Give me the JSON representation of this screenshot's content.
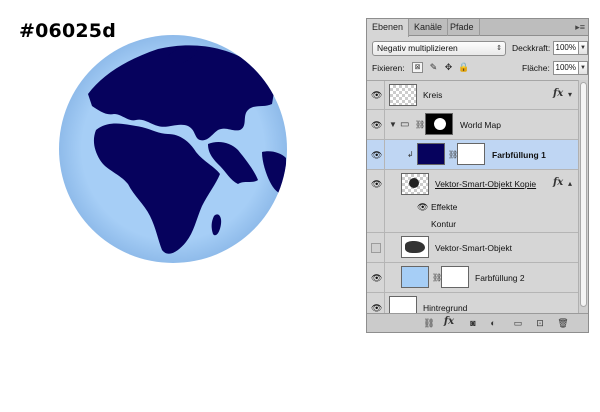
{
  "canvas_label": "#06025d",
  "colors": {
    "navy": "#06025d",
    "light_blue": "#a6cef6",
    "selection": "#bfd6f3"
  },
  "panel": {
    "tabs": [
      {
        "label": "Ebenen",
        "active": true
      },
      {
        "label": "Kanäle",
        "active": false
      },
      {
        "label": "Pfade",
        "active": false
      }
    ],
    "menu_icon": "panel-menu-icon",
    "blend_mode": "Negativ multiplizieren",
    "opacity_label": "Deckkraft:",
    "opacity_value": "100%",
    "lock_label": "Fixieren:",
    "fill_label": "Fläche:",
    "fill_value": "100%",
    "layers": {
      "kreis": {
        "name": "Kreis",
        "fx": "fx"
      },
      "world_map": {
        "name": "World Map"
      },
      "farbfuellung1": {
        "name": "Farbfüllung 1"
      },
      "vektor_kopie": {
        "name": "Vektor-Smart-Objekt Kopie",
        "fx": "fx"
      },
      "effekte": {
        "name": "Effekte"
      },
      "kontur": {
        "name": "Kontur"
      },
      "vektor": {
        "name": "Vektor-Smart-Objekt"
      },
      "farbfuellung2": {
        "name": "Farbfüllung 2"
      },
      "hintergrund": {
        "name": "Hintregrund"
      }
    },
    "bottom_fx": "fx"
  }
}
